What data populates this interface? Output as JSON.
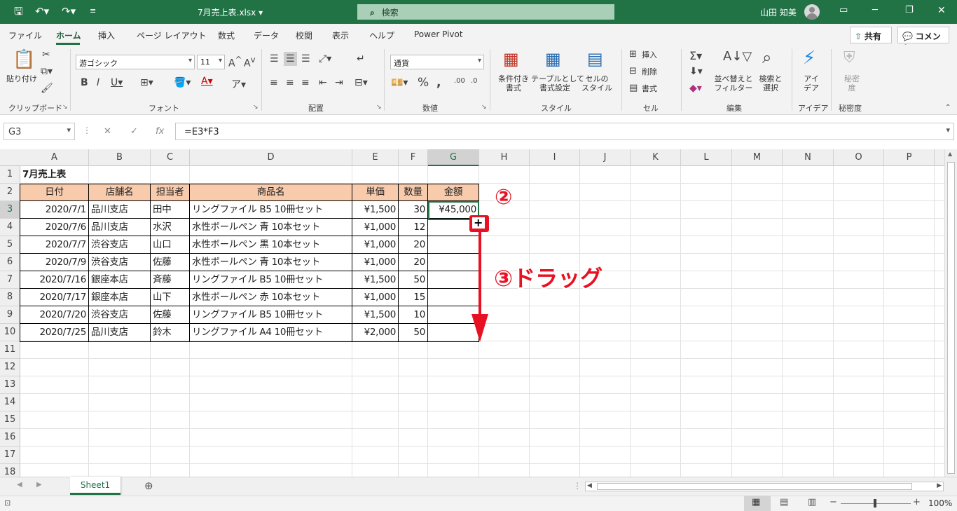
{
  "titlebar": {
    "filename": "7月売上表.xlsx",
    "search_label": "検索",
    "user": "山田 知美"
  },
  "menu_tabs": [
    "ファイル",
    "ホーム",
    "挿入",
    "ページ レイアウト",
    "数式",
    "データ",
    "校閲",
    "表示",
    "ヘルプ",
    "Power Pivot"
  ],
  "active_tab": "ホーム",
  "share_label": "共有",
  "comment_label": "コメント",
  "ribbon": {
    "paste": "貼り付け",
    "clipboard": "クリップボード",
    "font_name": "游ゴシック",
    "font_size": "11",
    "font": "フォント",
    "alignment": "配置",
    "number_format": "通貨",
    "number": "数値",
    "cond_format": "条件付き\n書式",
    "table_format": "テーブルとして\n書式設定",
    "cell_style": "セルの\nスタイル",
    "style": "スタイル",
    "insert": "挿入",
    "delete": "削除",
    "format": "書式",
    "cells": "セル",
    "sort_filter": "並べ替えと\nフィルター",
    "find_select": "検索と\n選択",
    "editing": "編集",
    "ideas": "アイ\nデア",
    "ideas_group": "アイデア",
    "sensitivity": "秘密\n度",
    "sensitivity_group": "秘密度"
  },
  "formula_bar": {
    "name_box": "G3",
    "formula": "=E3*F3"
  },
  "columns": [
    "A",
    "B",
    "C",
    "D",
    "E",
    "F",
    "G",
    "H",
    "I",
    "J",
    "K",
    "L",
    "M",
    "N",
    "O",
    "P"
  ],
  "rows": [
    "1",
    "2",
    "3",
    "4",
    "5",
    "6",
    "7",
    "8",
    "9",
    "10",
    "11",
    "12",
    "13",
    "14",
    "15",
    "16",
    "17",
    "18"
  ],
  "sheet": {
    "title": "7月売上表",
    "headers": [
      "日付",
      "店舗名",
      "担当者",
      "商品名",
      "単価",
      "数量",
      "金額"
    ],
    "data": [
      [
        "2020/7/1",
        "品川支店",
        "田中",
        "リングファイル B5 10冊セット",
        "¥1,500",
        "30",
        "¥45,000"
      ],
      [
        "2020/7/6",
        "品川支店",
        "水沢",
        "水性ボールペン 青 10本セット",
        "¥1,000",
        "12",
        ""
      ],
      [
        "2020/7/7",
        "渋谷支店",
        "山口",
        "水性ボールペン 黒 10本セット",
        "¥1,000",
        "20",
        ""
      ],
      [
        "2020/7/9",
        "渋谷支店",
        "佐藤",
        "水性ボールペン 青 10本セット",
        "¥1,000",
        "20",
        ""
      ],
      [
        "2020/7/16",
        "銀座本店",
        "斉藤",
        "リングファイル B5 10冊セット",
        "¥1,500",
        "50",
        ""
      ],
      [
        "2020/7/17",
        "銀座本店",
        "山下",
        "水性ボールペン 赤 10本セット",
        "¥1,000",
        "15",
        ""
      ],
      [
        "2020/7/20",
        "渋谷支店",
        "佐藤",
        "リングファイル B5 10冊セット",
        "¥1,500",
        "10",
        ""
      ],
      [
        "2020/7/25",
        "品川支店",
        "鈴木",
        "リングファイル A4 10冊セット",
        "¥2,000",
        "50",
        ""
      ]
    ]
  },
  "sheet_tab": "Sheet1",
  "zoom": "100%",
  "annotations": {
    "step2": "②",
    "step3": "③ドラッグ"
  },
  "colors": {
    "excel_green": "#217346",
    "header_fill": "#f8cbad",
    "annotation_red": "#e81123"
  }
}
